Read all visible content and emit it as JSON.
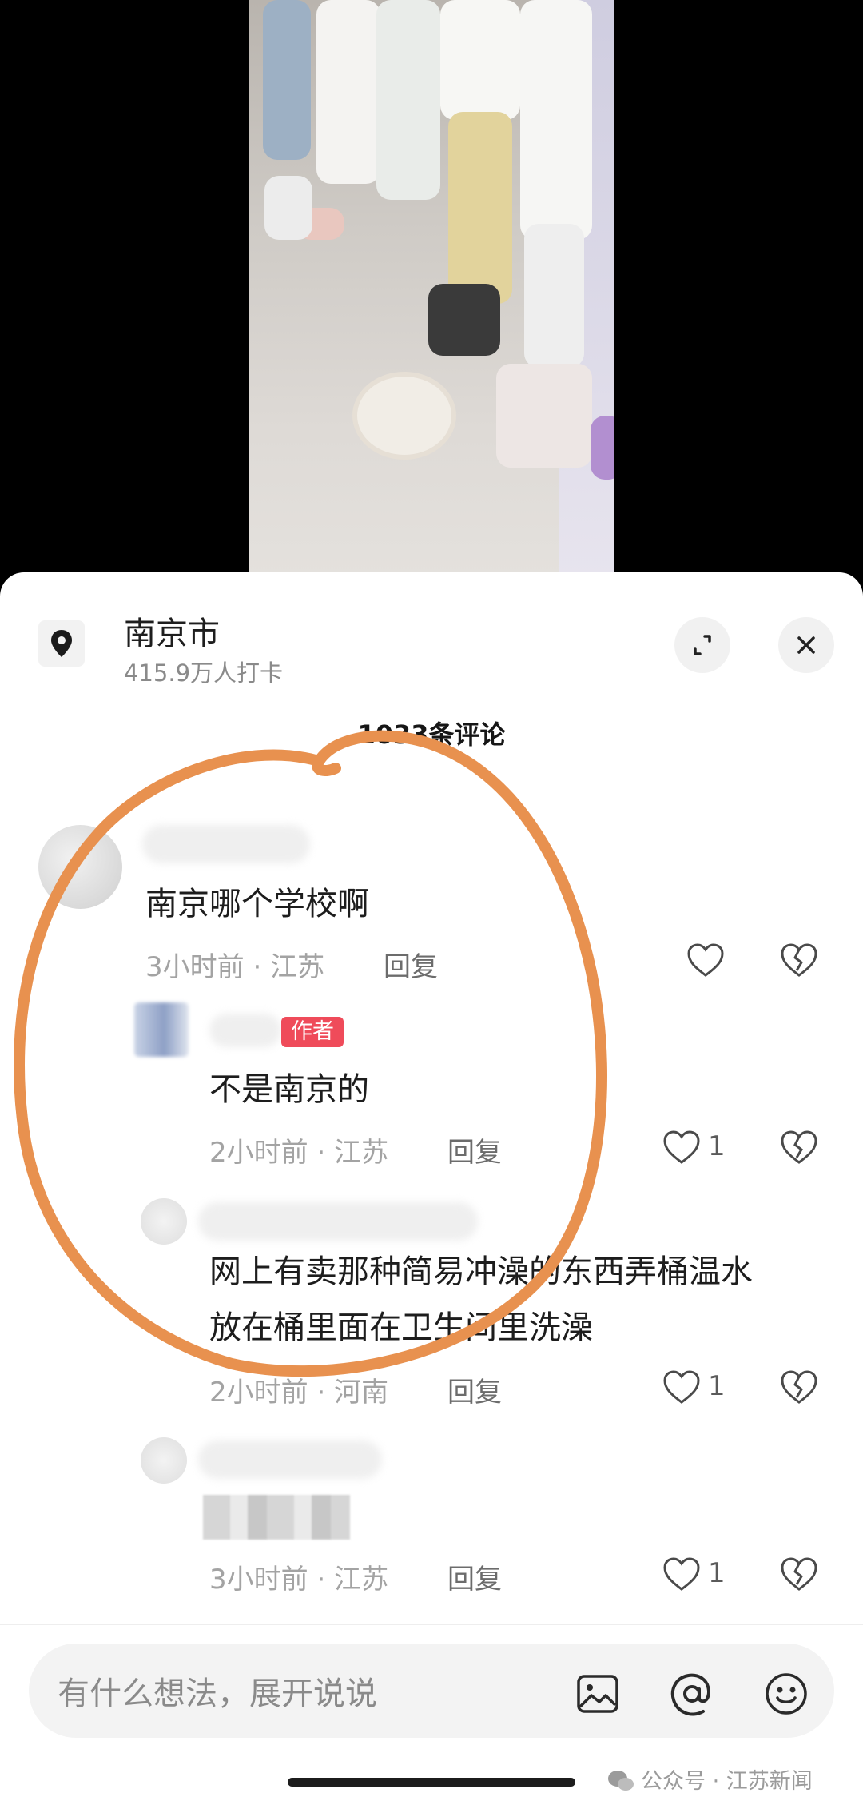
{
  "location": {
    "city": "南京市",
    "checkins": "415.9万人打卡"
  },
  "comments_header": "1033条评论",
  "comments": [
    {
      "text": "南京哪个学校啊",
      "time": "3小时前",
      "region": "江苏",
      "reply_label": "回复"
    },
    {
      "text": "不是南京的",
      "time": "2小时前",
      "region": "江苏",
      "reply_label": "回复",
      "author_tag": "作者",
      "likes": "1"
    },
    {
      "text_line1": "网上有卖那种简易冲澡的东西弄桶温水",
      "text_line2": "放在桶里面在卫生间里洗澡",
      "time": "2小时前",
      "region": "河南",
      "reply_label": "回复",
      "likes": "1"
    },
    {
      "time": "3小时前",
      "region": "江苏",
      "reply_label": "回复",
      "likes": "1"
    }
  ],
  "meta_separator": " · ",
  "input": {
    "placeholder": "有什么想法，展开说说"
  },
  "watermark": "公众号 · 江苏新闻",
  "colors": {
    "author_tag": "#ef4b5a",
    "annotation": "#e8914f"
  }
}
